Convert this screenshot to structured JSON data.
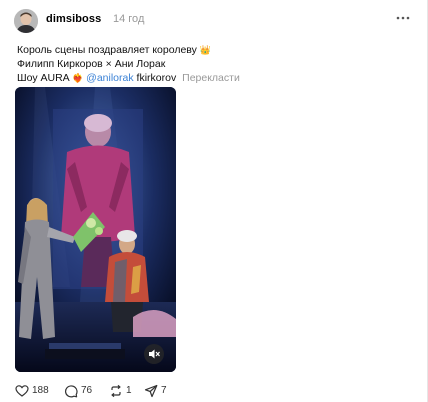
{
  "post": {
    "username": "dimsiboss",
    "time": "14 год",
    "line1": "Король сцены поздравляет королеву",
    "line1_emoji": "👑",
    "line2": "Филипп Киркоров × Ани Лорак",
    "line3_text": "Шоу AURA",
    "line3_emoji": "❤️‍🔥",
    "mention1": "@anilorak",
    "mention2": "fkirkorov",
    "translate_label": "Перекласти"
  },
  "actions": {
    "likes": "188",
    "comments": "76",
    "reposts": "1",
    "shares": "7"
  },
  "colors": {
    "link": "#3b82d6",
    "muted": "#999999",
    "stage_bg": "#0e1a3a"
  },
  "icons": {
    "more": "more-icon",
    "like": "heart-icon",
    "comment": "comment-icon",
    "repost": "repost-icon",
    "share": "share-icon",
    "mute": "muted-speaker-icon"
  }
}
